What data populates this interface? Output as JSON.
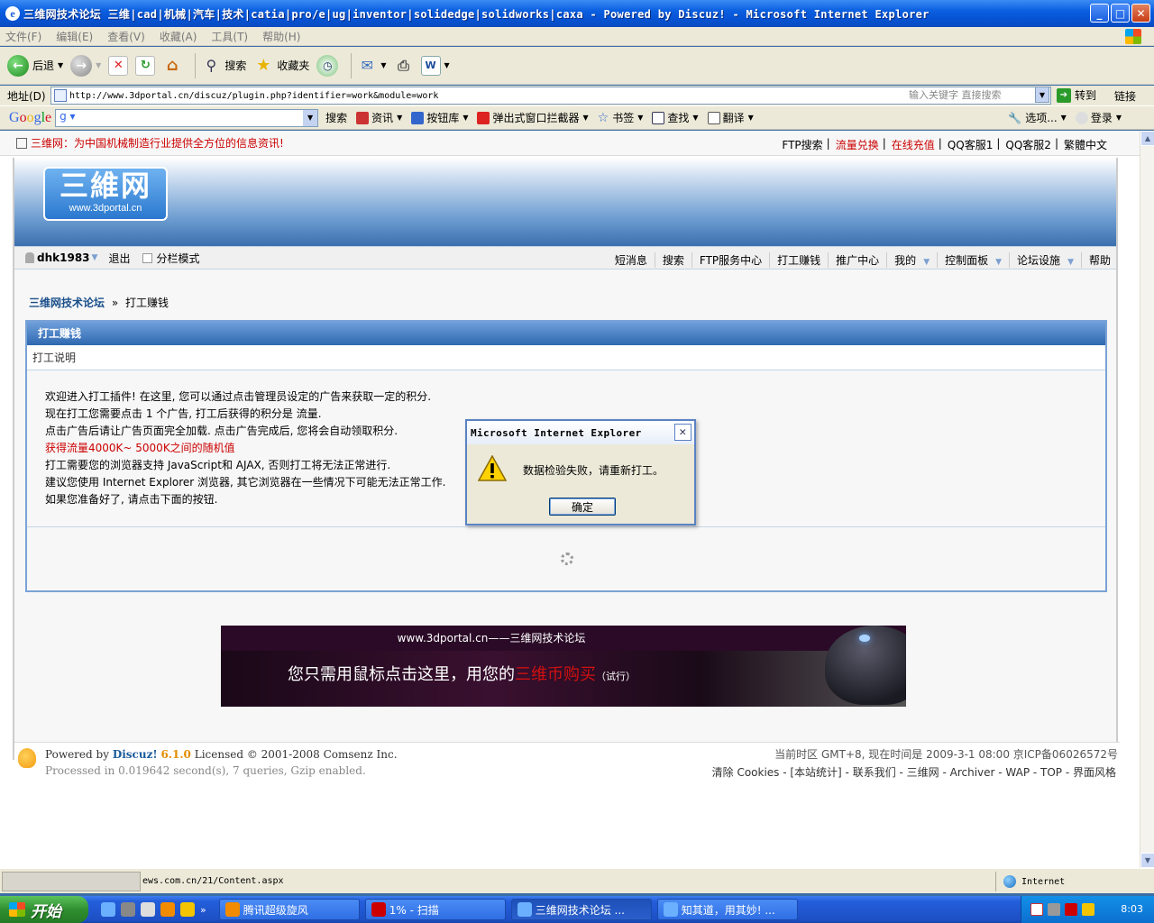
{
  "window": {
    "title": "三维网技术论坛 三维|cad|机械|汽车|技术|catia|pro/e|ug|inventor|solidedge|solidworks|caxa - Powered by Discuz! - Microsoft Internet Explorer",
    "ie_glyph": "e",
    "min_label": "_",
    "max_label": "□",
    "close_label": "✕"
  },
  "menubar": {
    "items": [
      "文件(F)",
      "编辑(E)",
      "查看(V)",
      "收藏(A)",
      "工具(T)",
      "帮助(H)"
    ]
  },
  "toolbar": {
    "back_label": "后退",
    "search_label": "搜索",
    "favorites_label": "收藏夹"
  },
  "addressbar": {
    "label": "地址(D)",
    "url": "http://www.3dportal.cn/discuz/plugin.php?identifier=work&module=work",
    "hint": "输入关键字 直接搜索",
    "go_label": "转到",
    "links_label": "链接"
  },
  "googlebar": {
    "logo": "Google",
    "search_label": "搜索",
    "news_label": "资讯",
    "pagerank_label": "按钮库",
    "popup_label": "弹出式窗口拦截器",
    "bookmarks_label": "书签",
    "find_label": "查找",
    "translate_label": "翻译",
    "options_label": "选项...",
    "login_label": "登录"
  },
  "topstrip": {
    "slogan": "三维网：为中国机械制造行业提供全方位的信息资讯!",
    "links": [
      {
        "text": "FTP搜索",
        "red": false
      },
      {
        "text": "流量兑换",
        "red": true
      },
      {
        "text": "在线充值",
        "red": true
      },
      {
        "text": "QQ客服1",
        "red": false
      },
      {
        "text": "QQ客服2",
        "red": false
      },
      {
        "text": "繁體中文",
        "red": false
      }
    ]
  },
  "site": {
    "logo_big": "三維网",
    "logo_small": "www.3dportal.cn"
  },
  "navbar": {
    "username": "dhk1983",
    "logout": "退出",
    "split_mode": "分栏模式",
    "items": [
      "短消息",
      "搜索",
      "FTP服务中心",
      "打工赚钱",
      "推广中心",
      "我的",
      "控制面板",
      "论坛设施",
      "帮助"
    ]
  },
  "breadcrumb": {
    "home": "三维网技术论坛",
    "sep": "»",
    "current": "打工赚钱"
  },
  "mainbox": {
    "header": "打工赚钱",
    "subheader": "打工说明",
    "lines": [
      {
        "text": "欢迎进入打工插件! 在这里, 您可以通过点击管理员设定的广告来获取一定的积分.",
        "red": false
      },
      {
        "text": "现在打工您需要点击 1 个广告, 打工后获得的积分是 流量.",
        "red": false
      },
      {
        "text": "点击广告后请让广告页面完全加载. 点击广告完成后, 您将会自动领取积分.",
        "red": false
      },
      {
        "text": "获得流量4000K~ 5000K之间的随机值",
        "red": true
      },
      {
        "text": "打工需要您的浏览器支持 JavaScript和 AJAX, 否则打工将无法正常进行.",
        "red": false
      },
      {
        "text": "建议您使用 Internet Explorer 浏览器, 其它浏览器在一些情况下可能无法正常工作.",
        "red": false
      },
      {
        "text": "如果您准备好了, 请点击下面的按钮.",
        "red": false
      }
    ]
  },
  "ad": {
    "top": "www.3dportal.cn——三维网技术论坛",
    "main_pre": "您只需用鼠标点击这里，用您的",
    "main_hl": "三维币购买",
    "main_trial": "（试行）"
  },
  "footer": {
    "powered_by": "Powered by",
    "discuz": "Discuz!",
    "version": "6.1.0",
    "licensed": "Licensed © 2001-2008 Comsenz Inc.",
    "processed": "Processed in 0.019642 second(s), 7 queries, Gzip enabled.",
    "timezone": "当前时区 GMT+8, 现在时间是 2009-3-1 08:00 京ICP备06026572号",
    "links": "清除 Cookies - [本站统计] - 联系我们 - 三维网 - Archiver - WAP - TOP - 界面风格"
  },
  "dialog": {
    "title": "Microsoft Internet Explorer",
    "message": "数据检验失败，请重新打工。",
    "ok_label": "确定",
    "close_label": "✕"
  },
  "statusbar": {
    "url": "ews.com.cn/21/Content.aspx",
    "zone": "Internet"
  },
  "taskbar": {
    "start_label": "开始",
    "tasks": [
      {
        "label": "腾讯超级旋风",
        "active": false
      },
      {
        "label": "1% - 扫描",
        "active": false
      },
      {
        "label": "三维网技术论坛 ...",
        "active": true
      },
      {
        "label": "知其道，用其妙! ...",
        "active": false
      }
    ],
    "clock": "8:03"
  }
}
